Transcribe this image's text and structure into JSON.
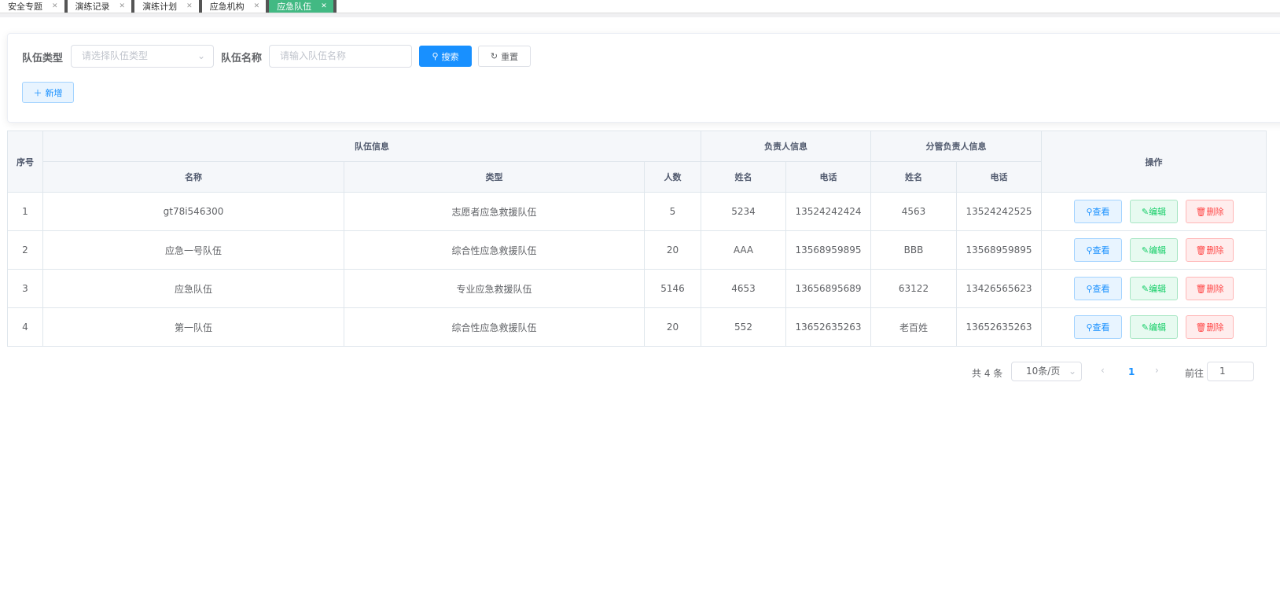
{
  "tabs": [
    {
      "label": "安全专题"
    },
    {
      "label": "演练记录"
    },
    {
      "label": "演练计划"
    },
    {
      "label": "应急机构"
    },
    {
      "label": "应急队伍",
      "active": true
    }
  ],
  "filters": {
    "type_label": "队伍类型",
    "type_placeholder": "请选择队伍类型",
    "name_label": "队伍名称",
    "name_placeholder": "请输入队伍名称",
    "search": "搜索",
    "reset": "重置",
    "add": "新增"
  },
  "table": {
    "group_headers": {
      "index": "序号",
      "team": "队伍信息",
      "leader": "负责人信息",
      "deputy": "分管负责人信息",
      "ops": "操作"
    },
    "sub_headers": {
      "name": "名称",
      "type": "类型",
      "count": "人数",
      "leader_name": "姓名",
      "leader_phone": "电话",
      "deputy_name": "姓名",
      "deputy_phone": "电话"
    },
    "rows": [
      [
        "1",
        "gt78i546300",
        "志愿者应急救援队伍",
        "5",
        "5234",
        "13524242424",
        "4563",
        "13524242525"
      ],
      [
        "2",
        "应急一号队伍",
        "综合性应急救援队伍",
        "20",
        "AAA",
        "13568959895",
        "BBB",
        "13568959895"
      ],
      [
        "3",
        "应急队伍",
        "专业应急救援队伍",
        "5146",
        "4653",
        "13656895689",
        "63122",
        "13426565623"
      ],
      [
        "4",
        "第一队伍",
        "综合性应急救援队伍",
        "20",
        "552",
        "13652635263",
        "老百姓",
        "13652635263"
      ]
    ],
    "actions": {
      "view": "查看",
      "edit": "编辑",
      "delete": "删除"
    }
  },
  "pagination": {
    "total": "共 4 条",
    "page_size": "10条/页",
    "current": "1",
    "goto_label": "前往",
    "goto_value": "1"
  },
  "colors": {
    "primary": "#1890ff",
    "active_tab": "#42b983"
  }
}
